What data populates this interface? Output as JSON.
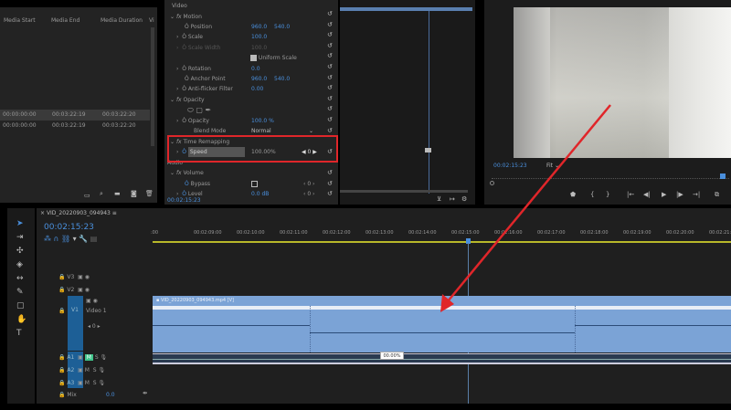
{
  "project_panel": {
    "columns": [
      "Media Start",
      "Media End",
      "Media Duration",
      "Vi"
    ],
    "rows": [
      [
        "00:00:00:00",
        "00:03:22:19",
        "00:03:22:20"
      ],
      [
        "00:00:00:00",
        "00:03:22:19",
        "00:03:22:20"
      ]
    ]
  },
  "effect_controls": {
    "section_video": "Video",
    "motion": "Motion",
    "position": {
      "label": "Position",
      "x": "960.0",
      "y": "540.0"
    },
    "scale": {
      "label": "Scale",
      "value": "100.0"
    },
    "scale_width": {
      "label": "Scale Width",
      "value": "100.0"
    },
    "uniform_scale": "Uniform Scale",
    "rotation": {
      "label": "Rotation",
      "value": "0.0"
    },
    "anchor": {
      "label": "Anchor Point",
      "x": "960.0",
      "y": "540.0"
    },
    "antiflicker": {
      "label": "Anti-flicker Filter",
      "value": "0.00"
    },
    "opacity_section": "Opacity",
    "opacity": {
      "label": "Opacity",
      "value": "100.0 %"
    },
    "blend": {
      "label": "Blend Mode",
      "value": "Normal"
    },
    "time_remap": "Time Remapping",
    "speed": {
      "label": "Speed",
      "value": "100.00%",
      "kf": "0"
    },
    "section_audio": "Audio",
    "volume": "Volume",
    "bypass": {
      "label": "Bypass",
      "kf": "0"
    },
    "level": {
      "label": "Level",
      "value": "0.0 dB",
      "kf": "0"
    },
    "timecode": "00:02:15:23"
  },
  "program": {
    "timecode": "00:02:15:23",
    "fit": "Fit"
  },
  "timeline": {
    "sequence_name": "VID_20220903_094943",
    "timecode": "00:02:15:23",
    "ruler": [
      ":00",
      "00:02:09:00",
      "00:02:10:00",
      "00:02:11:00",
      "00:02:12:00",
      "00:02:13:00",
      "00:02:14:00",
      "00:02:15:00",
      "00:02:16:00",
      "00:02:17:00",
      "00:02:18:00",
      "00:02:19:00",
      "00:02:20:00",
      "00:02:21:00"
    ],
    "tracks": {
      "v3": "V3",
      "v2": "V2",
      "v1": "V1",
      "video1": "Video 1",
      "a1": "A1",
      "a2": "A2",
      "a3": "A3",
      "mix": "Mix",
      "mix_value": "0.0",
      "m": "M",
      "s": "S"
    },
    "clip_name": "VID_20220903_094943.mp4 [V]",
    "speed_tooltip": "00.00%",
    "v1_kf": "0"
  },
  "colors": {
    "accent": "#4a8fdc",
    "clip": "#7ba3d6",
    "highlight": "#e0262a",
    "playhead_bar": "#b8b82a"
  }
}
